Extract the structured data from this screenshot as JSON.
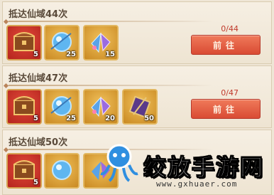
{
  "tasks": [
    {
      "title": "抵达仙域44次",
      "progress": "0/44",
      "button": "前往",
      "rewards": [
        {
          "kind": "treasure-chest",
          "count": "5"
        },
        {
          "kind": "blue-orb",
          "count": "25"
        },
        {
          "kind": "butterfly-wing",
          "count": "15"
        }
      ]
    },
    {
      "title": "抵达仙域47次",
      "progress": "0/47",
      "button": "前往",
      "rewards": [
        {
          "kind": "treasure-chest",
          "count": "5"
        },
        {
          "kind": "blue-orb",
          "count": "25"
        },
        {
          "kind": "butterfly-wing",
          "count": "20"
        },
        {
          "kind": "purple-scroll",
          "count": "50"
        }
      ]
    },
    {
      "title": "抵达仙域50次",
      "progress": "",
      "button": "",
      "rewards": [
        {
          "kind": "treasure-chest",
          "count": "5"
        },
        {
          "kind": "blue-orb",
          "count": ""
        },
        {
          "kind": "butterfly-wing",
          "count": ""
        }
      ]
    }
  ],
  "watermark": {
    "text": "绞放手游网",
    "url": "www.gxhuaer.com"
  },
  "colors": {
    "button_bg": "#e05a3f",
    "progress_text": "#c0392b",
    "panel_bg": "#f3ebdd"
  }
}
